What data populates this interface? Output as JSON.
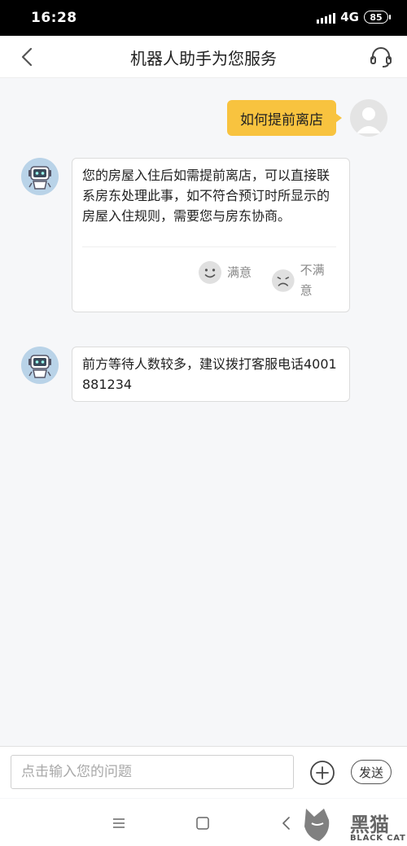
{
  "status_bar": {
    "time": "16:28",
    "network": "4G",
    "battery": "85"
  },
  "header": {
    "title": "机器人助手为您服务",
    "back_icon": "chevron-left-icon",
    "service_icon": "headset-icon"
  },
  "messages": [
    {
      "from": "user",
      "text": "如何提前离店"
    },
    {
      "from": "bot",
      "text": "您的房屋入住后如需提前离店，可以直接联系房东处理此事，如不符合预订时所显示的房屋入住规则，需要您与房东协商。"
    },
    {
      "from": "bot",
      "text": "前方等待人数较多，建议拨打客服电话4001881234"
    }
  ],
  "rating": {
    "satisfied": "满意",
    "unsatisfied": "不满意"
  },
  "input": {
    "placeholder": "点击输入您的问题",
    "value": "",
    "send_label": "发送"
  },
  "watermark": {
    "text": "黑猫",
    "sub": "BLACK CAT"
  },
  "colors": {
    "accent": "#f8c33f",
    "background": "#f6f7f9",
    "bot_avatar": "#b9d3e8"
  }
}
